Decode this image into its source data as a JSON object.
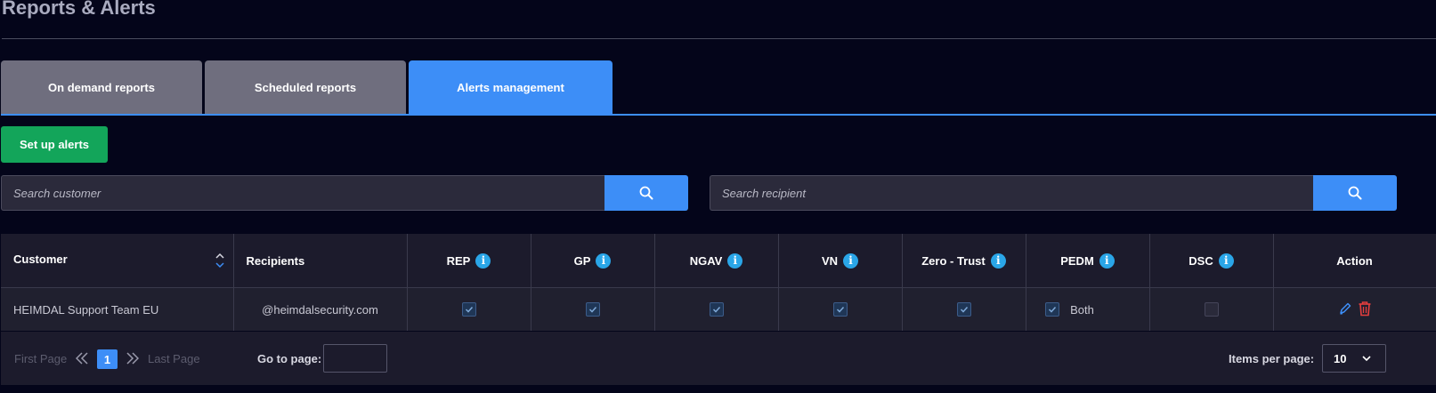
{
  "page": {
    "title": "Reports & Alerts"
  },
  "tabs": [
    {
      "label": "On demand reports",
      "active": false
    },
    {
      "label": "Scheduled reports",
      "active": false
    },
    {
      "label": "Alerts management",
      "active": true
    }
  ],
  "actions": {
    "setup_label": "Set up alerts"
  },
  "search": {
    "customer_placeholder": "Search customer",
    "recipient_placeholder": "Search recipient"
  },
  "table": {
    "headers": {
      "customer": "Customer",
      "recipients": "Recipients",
      "rep": "REP",
      "gp": "GP",
      "ngav": "NGAV",
      "vn": "VN",
      "zero_trust": "Zero - Trust",
      "pedm": "PEDM",
      "dsc": "DSC",
      "action": "Action"
    },
    "rows": [
      {
        "customer": "HEIMDAL Support Team EU",
        "recipients": "@heimdalsecurity.com",
        "rep": true,
        "gp": true,
        "ngav": true,
        "vn": true,
        "zero_trust": true,
        "pedm": true,
        "pedm_text": "Both",
        "dsc": false
      }
    ]
  },
  "pagination": {
    "first_label": "First Page",
    "last_label": "Last Page",
    "current_page": "1",
    "goto_label": "Go to page:",
    "goto_value": "",
    "items_per_page_label": "Items per page:",
    "items_per_page_value": "10"
  },
  "colors": {
    "background": "#04051a",
    "accent": "#3d8ef7",
    "success": "#13a55a",
    "tab_inactive": "#6f6e7e",
    "info": "#2aa6e8",
    "delete": "#e53e3e"
  },
  "icons": {
    "search": "search-icon",
    "info": "info-icon",
    "sort": "sort-icon",
    "edit": "pencil-icon",
    "delete": "trash-icon",
    "first": "double-chevron-left-icon",
    "last": "double-chevron-right-icon",
    "dropdown": "chevron-down-icon"
  }
}
